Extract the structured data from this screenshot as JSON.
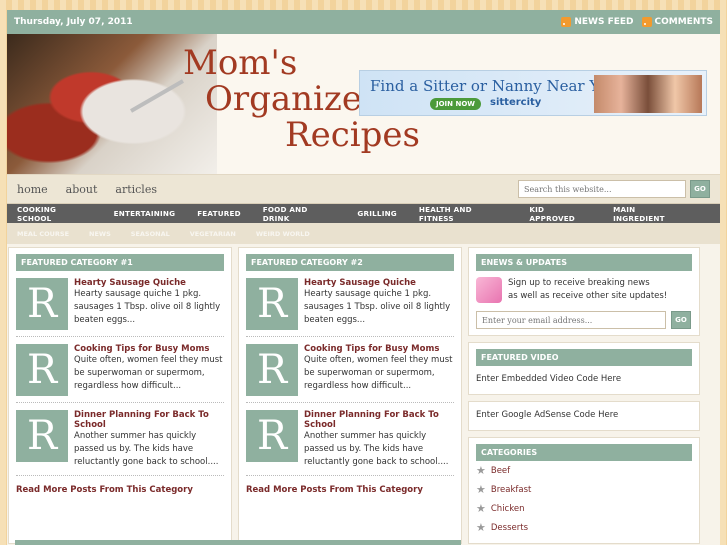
{
  "topbar": {
    "date": "Thursday, July 07, 2011",
    "news_feed": "NEWS FEED",
    "comments": "COMMENTS"
  },
  "header": {
    "logo_line1": "Mom's",
    "logo_line2": "Organized",
    "logo_line3": "Recipes",
    "ad_text": "Find a Sitter or Nanny Near You",
    "ad_join": "JOIN NOW",
    "ad_brand": "sittercity"
  },
  "nav": {
    "items": [
      "home",
      "about",
      "articles"
    ],
    "search_placeholder": "Search this website...",
    "go": "GO"
  },
  "catnav": [
    "COOKING SCHOOL",
    "ENTERTAINING",
    "FEATURED",
    "FOOD AND DRINK",
    "GRILLING",
    "HEALTH AND FITNESS",
    "KID APPROVED",
    "MAIN INGREDIENT"
  ],
  "subnav": [
    "MEAL COURSE",
    "NEWS",
    "SEASONAL",
    "VEGETARIAN",
    "WEIRD WORLD"
  ],
  "col1": {
    "title": "FEATURED CATEGORY #1",
    "posts": [
      {
        "title": "Hearty Sausage Quiche",
        "excerpt": "Hearty sausage quiche 1 pkg. sausages 1 Tbsp. olive oil 8 lightly beaten eggs..."
      },
      {
        "title": "Cooking Tips for Busy Moms",
        "excerpt": "Quite often, women feel they must be superwoman or supermom, regardless how difficult..."
      },
      {
        "title": "Dinner Planning For Back To School",
        "excerpt": "Another summer has quickly passed us by. The kids have reluctantly gone back to school...."
      }
    ],
    "more": "Read More Posts From This Category"
  },
  "col2": {
    "title": "FEATURED CATEGORY #2",
    "posts": [
      {
        "title": "Hearty Sausage Quiche",
        "excerpt": "Hearty sausage quiche 1 pkg. sausages 1 Tbsp. olive oil 8 lightly beaten eggs..."
      },
      {
        "title": "Cooking Tips for Busy Moms",
        "excerpt": "Quite often, women feel they must be superwoman or supermom, regardless how difficult..."
      },
      {
        "title": "Dinner Planning For Back To School",
        "excerpt": "Another summer has quickly passed us by. The kids have reluctantly gone back to school...."
      }
    ],
    "more": "Read More Posts From This Category"
  },
  "thumb_letter": "R",
  "sidebar": {
    "enews_title": "ENEWS & UPDATES",
    "enews_text1": "Sign up to receive breaking news",
    "enews_text2": "as well as receive other site updates!",
    "email_placeholder": "Enter your email address...",
    "go": "GO",
    "video_title": "FEATURED VIDEO",
    "video_text": "Enter Embedded Video Code Here",
    "adsense_text": "Enter Google AdSense Code Here",
    "categories_title": "CATEGORIES",
    "categories": [
      "Beef",
      "Breakfast",
      "Chicken",
      "Desserts"
    ]
  }
}
